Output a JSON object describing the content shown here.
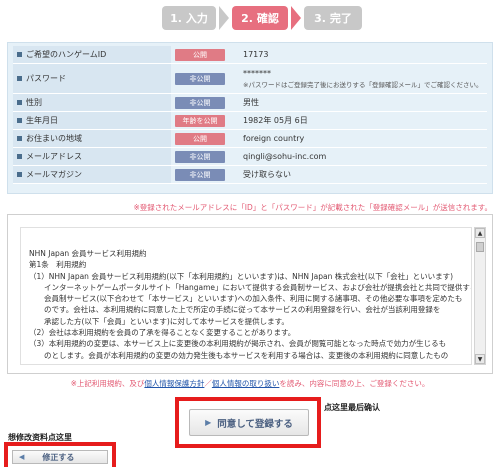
{
  "steps": [
    {
      "label": "1. 入力"
    },
    {
      "label": "2. 確認"
    },
    {
      "label": "3. 完了"
    }
  ],
  "info_rows": [
    {
      "label": "ご希望のハンゲームID",
      "badge": "公開",
      "value": "17173"
    },
    {
      "label": "パスワード",
      "badge": "非公開",
      "value": "*******",
      "note": "※パスワードはご登録完了後にお送りする「登録確認メール」でご確認ください。"
    },
    {
      "label": "性別",
      "badge": "非公開",
      "value": "男性"
    },
    {
      "label": "生年月日",
      "badge": "年齢を公開",
      "value": "1982年 05月 6日"
    },
    {
      "label": "お住まいの地域",
      "badge": "公開",
      "value": "foreign country"
    },
    {
      "label": "メールアドレス",
      "badge": "非公開",
      "value": "qingli@sohu-inc.com"
    },
    {
      "label": "メールマガジン",
      "badge": "非公開",
      "value": "受け取らない"
    }
  ],
  "notice_top": "※登録されたメールアドレスに「ID」と「パスワード」が記載された「登録確認メール」が送信されます。",
  "terms": {
    "lines": [
      "NHN Japan 会員サービス利用規約",
      "第1条　利用規約",
      "（1）NHN Japan 会員サービス利用規約(以下「本利用規約」といいます)は、NHN Japan 株式会社(以下「会社」といいます)",
      "　　インターネットゲームポータルサイト「Hangame」において提供する会員制サービス、および会社が提携会社と共同で提供する",
      "　　会員制サービス(以下合わせて「本サービス」といいます)への加入条件、利用に関する諸事項、その他必要な事項を定めたも",
      "　　のです。会社は、本利用規約に同意した上で所定の手続に従って本サービスの利用登録を行い、会社が当該利用登録を",
      "　　承認した方(以下「会員」といいます)に対して本サービスを提供します。",
      "（2）会社は本利用規約を会員の了承を得ることなく変更することがあります。",
      "（3）本利用規約の変更は、本サービス上に変更後の本利用規約が掲示され、会員が閲覧可能となった時点で効力が生じるも",
      "　　のとします。会員が本利用規約の変更の効力発生後も本サービスを利用する場合は、変更後の本利用規約に同意したもの"
    ]
  },
  "notice_bottom": {
    "prefix": "※上記利用規約、及び",
    "link1": "個人情報保護方針",
    "sep": "／",
    "link2": "個人情報の取り扱い",
    "suffix": "を読み、内容に同意の上、ご登録ください。"
  },
  "buttons": {
    "agree": "同意して登録する",
    "edit": "修正する"
  },
  "annotations": {
    "right": "点这里最后确认",
    "left": "想修改资料点这里"
  }
}
